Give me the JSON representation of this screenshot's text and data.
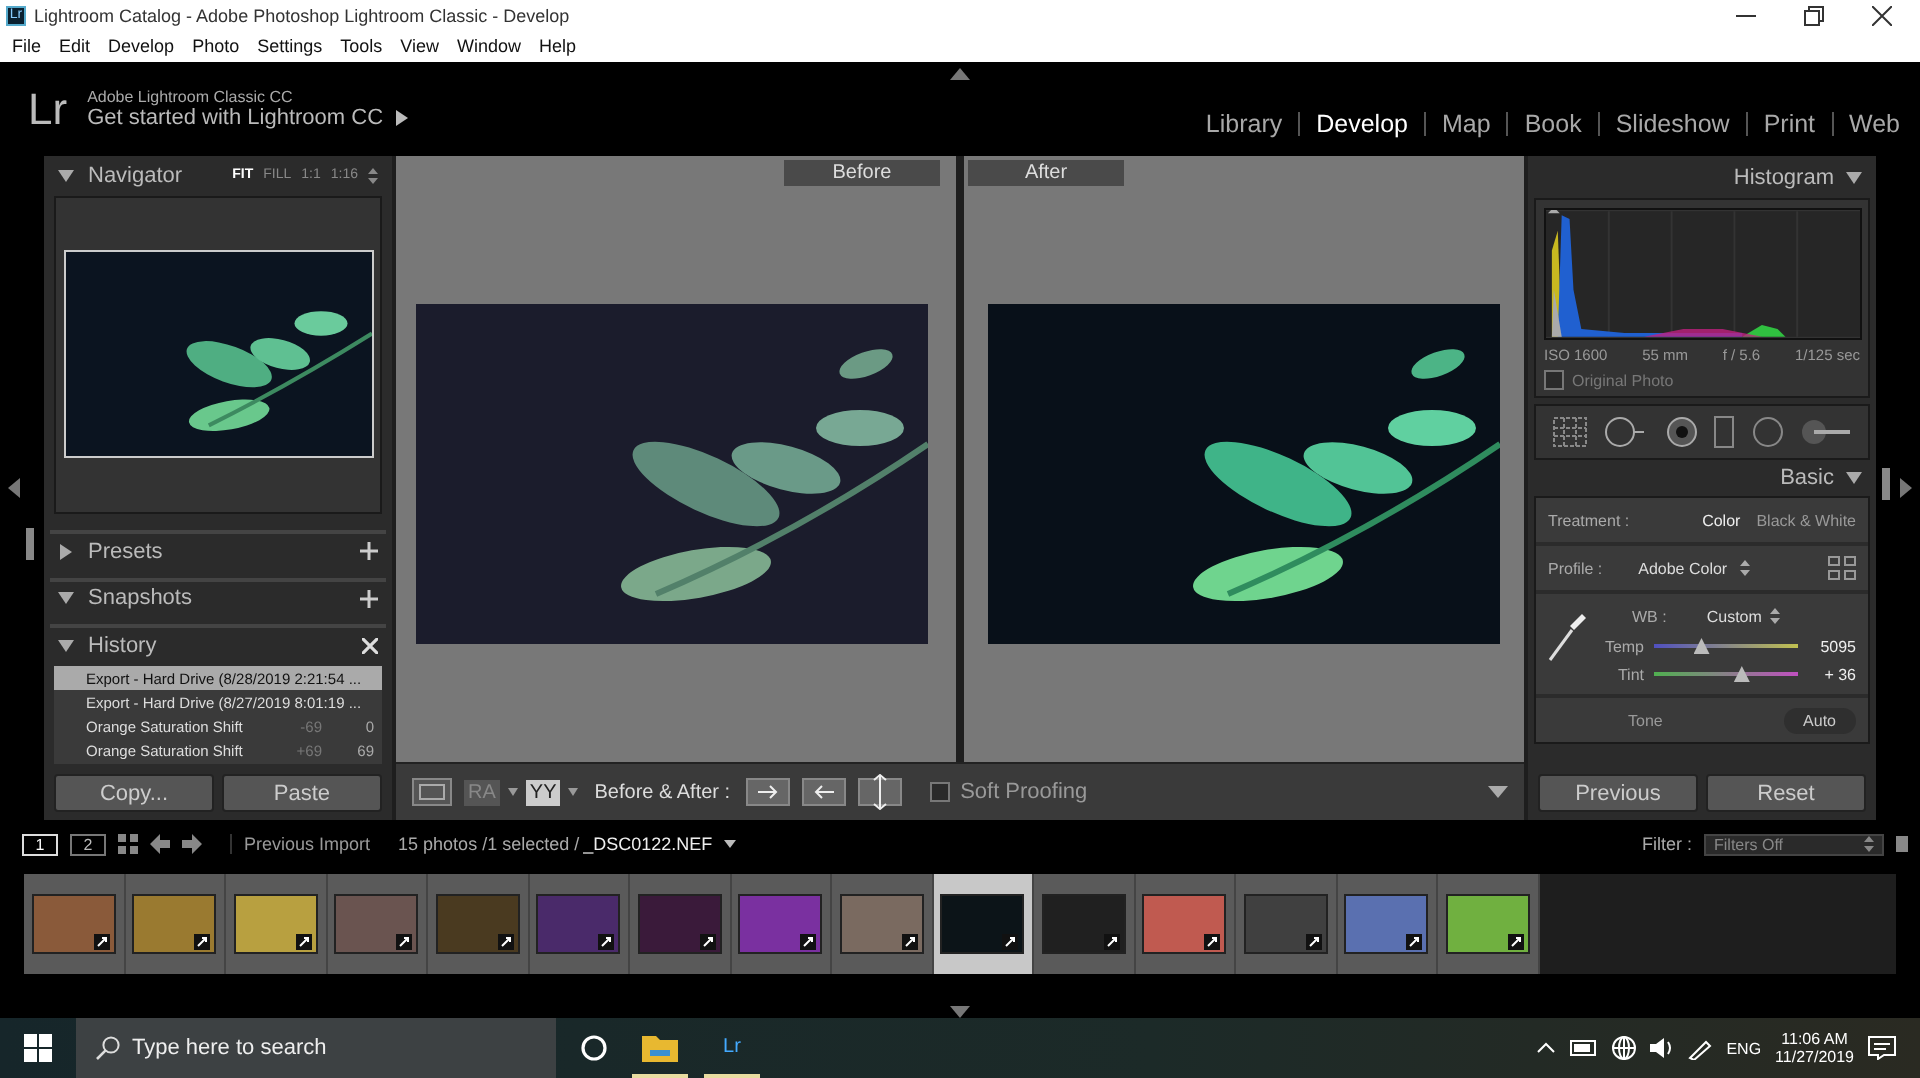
{
  "window": {
    "icon_text": "Lr",
    "title": "Lightroom Catalog - Adobe Photoshop Lightroom Classic - Develop"
  },
  "menu": [
    "File",
    "Edit",
    "Develop",
    "Photo",
    "Settings",
    "Tools",
    "View",
    "Window",
    "Help"
  ],
  "identity": {
    "logo": "Lr",
    "product": "Adobe Lightroom Classic CC",
    "prompt": "Get started with Lightroom CC"
  },
  "modules": [
    {
      "label": "Library",
      "selected": false
    },
    {
      "label": "Develop",
      "selected": true
    },
    {
      "label": "Map",
      "selected": false
    },
    {
      "label": "Book",
      "selected": false
    },
    {
      "label": "Slideshow",
      "selected": false
    },
    {
      "label": "Print",
      "selected": false
    },
    {
      "label": "Web",
      "selected": false
    }
  ],
  "navigator": {
    "title": "Navigator",
    "zoom_options": [
      {
        "label": "FIT",
        "selected": true
      },
      {
        "label": "FILL",
        "selected": false
      },
      {
        "label": "1:1",
        "selected": false
      },
      {
        "label": "1:16",
        "selected": false
      }
    ]
  },
  "left_panels": [
    {
      "title": "Presets",
      "expanded": false,
      "has_add": true
    },
    {
      "title": "Snapshots",
      "expanded": true,
      "has_add": true
    }
  ],
  "history": {
    "title": "History",
    "expanded": true,
    "items": [
      {
        "name": "Export - Hard Drive (8/28/2019 2:21:54 ...",
        "selected": true
      },
      {
        "name": "Export - Hard Drive (8/27/2019 8:01:19 ...",
        "selected": false
      },
      {
        "name": "Orange Saturation Shift",
        "before": "-69",
        "after": "0",
        "selected": false
      },
      {
        "name": "Orange Saturation Shift",
        "before": "+69",
        "after": "69",
        "selected": false
      }
    ]
  },
  "left_buttons": [
    "Copy...",
    "Paste"
  ],
  "compare": {
    "before_label": "Before",
    "after_label": "After"
  },
  "toolbar": {
    "view_modes": [
      {
        "label": "RA",
        "selected": false
      },
      {
        "label": "YY",
        "selected": true
      }
    ],
    "before_after_label": "Before & After :",
    "soft_proofing": {
      "label": "Soft Proofing",
      "checked": false
    }
  },
  "histogram": {
    "title": "Histogram",
    "exif": [
      "ISO 1600",
      "55 mm",
      "f / 5.6",
      "1/125 sec"
    ],
    "original_photo": {
      "label": "Original Photo",
      "checked": false
    }
  },
  "basic": {
    "title": "Basic",
    "treatment_label": "Treatment :",
    "treatment_options": [
      {
        "label": "Color",
        "selected": true
      },
      {
        "label": "Black & White",
        "selected": false
      }
    ],
    "profile_label": "Profile :",
    "profile_value": "Adobe Color",
    "wb_label": "WB :",
    "wb_value": "Custom",
    "sliders": [
      {
        "name": "Temp",
        "level": 0.33,
        "reading": "5095"
      },
      {
        "name": "Tint",
        "level": 0.61,
        "reading": "+ 36"
      }
    ],
    "tone_label": "Tone",
    "auto_button": "Auto"
  },
  "right_buttons": [
    "Previous",
    "Reset"
  ],
  "filmstrip": {
    "pages": [
      {
        "label": "1",
        "selected": true
      },
      {
        "label": "2",
        "selected": false
      }
    ],
    "source": "Previous Import",
    "info": "15 photos /1 selected /",
    "file": "_DSC0122.NEF",
    "filter_label": "Filter :",
    "filter_value": "Filters Off",
    "thumbnails": [
      {
        "color": "#8a5a3a",
        "selected": false
      },
      {
        "color": "#9a7a30",
        "selected": false
      },
      {
        "color": "#b8a040",
        "selected": false
      },
      {
        "color": "#6a5450",
        "selected": false
      },
      {
        "color": "#4a3a20",
        "selected": false
      },
      {
        "color": "#4a2a6a",
        "selected": false
      },
      {
        "color": "#3a1a3a",
        "selected": false
      },
      {
        "color": "#7a30a0",
        "selected": false
      },
      {
        "color": "#7a6a60",
        "selected": false
      },
      {
        "color": "#0c1418",
        "selected": true
      },
      {
        "color": "#202020",
        "selected": false
      },
      {
        "color": "#c05a50",
        "selected": false
      },
      {
        "color": "#404040",
        "selected": false
      },
      {
        "color": "#5a70b0",
        "selected": false
      },
      {
        "color": "#70b040",
        "selected": false
      }
    ]
  },
  "taskbar": {
    "search_placeholder": "Type here to search",
    "app_logo": "Lr",
    "language": "ENG",
    "time": "11:06 AM",
    "date": "11/27/2019"
  }
}
